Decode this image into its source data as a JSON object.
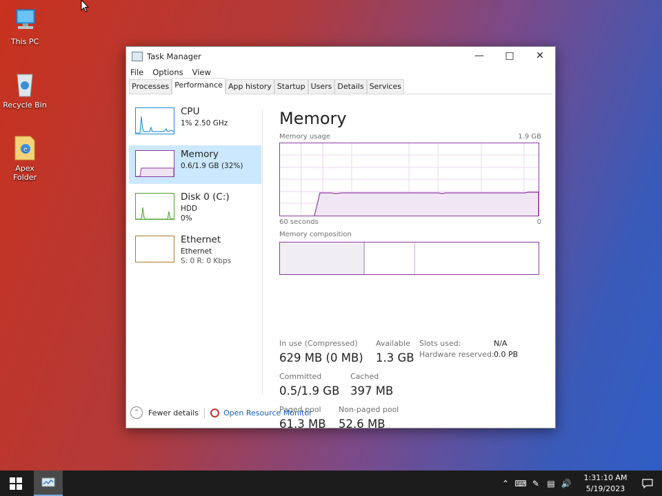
{
  "desktop": {
    "icons": [
      {
        "label": "This PC"
      },
      {
        "label": "Recycle Bin"
      },
      {
        "label": "Apex Folder"
      }
    ]
  },
  "window": {
    "title": "Task Manager",
    "menu": [
      "File",
      "Options",
      "View"
    ],
    "tabs": [
      "Processes",
      "Performance",
      "App history",
      "Startup",
      "Users",
      "Details",
      "Services"
    ],
    "active_tab": "Performance"
  },
  "sidebar": {
    "items": [
      {
        "title": "CPU",
        "line1": "1% 2.50 GHz",
        "line2": "",
        "color": "#1a8ad4"
      },
      {
        "title": "Memory",
        "line1": "0.6/1.9 GB (32%)",
        "line2": "",
        "color": "#8b3a9f"
      },
      {
        "title": "Disk 0 (C:)",
        "line1": "HDD",
        "line2": "0%",
        "color": "#4ca32a"
      },
      {
        "title": "Ethernet",
        "line1": "Ethernet",
        "line2": "S: 0 R: 0 Kbps",
        "color": "#a77a2a"
      }
    ],
    "active": "Memory"
  },
  "memory": {
    "heading": "Memory",
    "usage_label": "Memory usage",
    "usage_max": "1.9 GB",
    "time_left": "60 seconds",
    "time_right": "0",
    "composition_label": "Memory composition",
    "stats": {
      "in_use_label": "In use (Compressed)",
      "in_use_value": "629 MB (0 MB)",
      "available_label": "Available",
      "available_value": "1.3 GB",
      "slots_label": "Slots used:",
      "slots_value": "N/A",
      "hw_reserved_label": "Hardware reserved:",
      "hw_reserved_value": "0.0 PB",
      "committed_label": "Committed",
      "committed_value": "0.5/1.9 GB",
      "cached_label": "Cached",
      "cached_value": "397 MB",
      "paged_label": "Paged pool",
      "paged_value": "61.3 MB",
      "nonpaged_label": "Non-paged pool",
      "nonpaged_value": "52.6 MB"
    }
  },
  "footer": {
    "fewer_details": "Fewer details",
    "open_monitor": "Open Resource Monitor"
  },
  "taskbar": {
    "time": "1:31:10 AM",
    "date": "5/19/2023"
  }
}
